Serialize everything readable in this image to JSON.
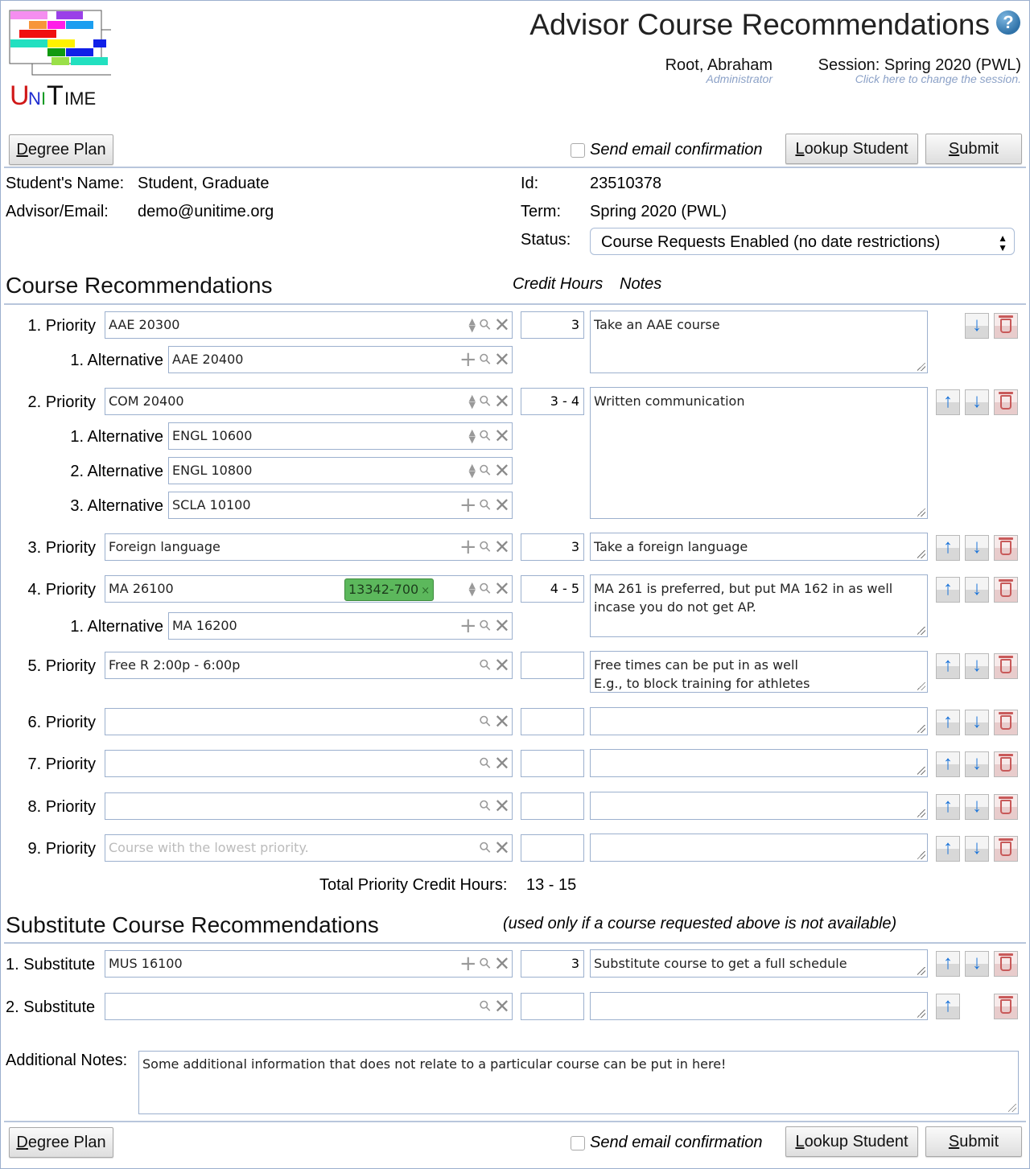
{
  "header": {
    "app_name": "UniTime",
    "title": "Advisor Course Recommendations",
    "help_icon": "?",
    "user_name": "Root, Abraham",
    "user_role": "Administrator",
    "session": "Session: Spring 2020 (PWL)",
    "session_hint": "Click here to change the session."
  },
  "toolbar": {
    "degree_plan": "Degree Plan",
    "send_email": "Send email confirmation",
    "send_email_checked": false,
    "lookup_student": "Lookup Student",
    "submit": "Submit"
  },
  "student": {
    "name_label": "Student's Name:",
    "name": "Student, Graduate",
    "advisor_label": "Advisor/Email:",
    "advisor_email": "demo@unitime.org",
    "id_label": "Id:",
    "id": "23510378",
    "term_label": "Term:",
    "term": "Spring 2020 (PWL)",
    "status_label": "Status:",
    "status": "Course Requests Enabled (no date restrictions)"
  },
  "recommendations": {
    "heading": "Course Recommendations",
    "credit_header": "Credit Hours",
    "notes_header": "Notes",
    "priorities": [
      {
        "label": "1. Priority",
        "course": "AAE 20300",
        "credit": "3",
        "notes": "Take an AAE course",
        "alternatives": [
          {
            "label": "1. Alternative",
            "course": "AAE 20400"
          }
        ]
      },
      {
        "label": "2. Priority",
        "course": "COM 20400",
        "credit": "3 - 4",
        "notes": "Written communication",
        "alternatives": [
          {
            "label": "1. Alternative",
            "course": "ENGL 10600"
          },
          {
            "label": "2. Alternative",
            "course": "ENGL 10800"
          },
          {
            "label": "3. Alternative",
            "course": "SCLA 10100"
          }
        ]
      },
      {
        "label": "3. Priority",
        "course": "Foreign language",
        "credit": "3",
        "notes": "Take a foreign language",
        "alternatives": []
      },
      {
        "label": "4. Priority",
        "course": "MA 26100",
        "section_tag": "13342-700",
        "credit": "4 - 5",
        "notes": "MA 261 is preferred, but put MA 162 in as well\nincase you do not get AP.",
        "alternatives": [
          {
            "label": "1. Alternative",
            "course": "MA 16200"
          }
        ]
      },
      {
        "label": "5. Priority",
        "course": "Free R 2:00p - 6:00p",
        "credit": "",
        "notes": "Free times can be put in as well\nE.g., to block training for athletes",
        "alternatives": []
      },
      {
        "label": "6. Priority",
        "course": "",
        "credit": "",
        "notes": "",
        "alternatives": []
      },
      {
        "label": "7. Priority",
        "course": "",
        "credit": "",
        "notes": "",
        "alternatives": []
      },
      {
        "label": "8. Priority",
        "course": "",
        "credit": "",
        "notes": "",
        "alternatives": []
      },
      {
        "label": "9. Priority",
        "course": "",
        "placeholder": "Course with the lowest priority.",
        "credit": "",
        "notes": "",
        "alternatives": []
      }
    ],
    "total_label": "Total Priority Credit Hours:",
    "total_value": "13 - 15"
  },
  "substitutes": {
    "heading": "Substitute Course Recommendations",
    "subheading": "(used only if a course requested above is not available)",
    "items": [
      {
        "label": "1. Substitute",
        "course": "MUS 16100",
        "credit": "3",
        "notes": "Substitute course to get a full schedule"
      },
      {
        "label": "2. Substitute",
        "course": "",
        "credit": "",
        "notes": ""
      }
    ]
  },
  "additional_notes": {
    "label": "Additional Notes:",
    "value": "Some additional information that does not relate to a particular course can be put in here!"
  },
  "colors": {
    "border": "#9cb0ce",
    "section_tag": "#5cb85c",
    "move_arrow": "#1a73d9",
    "delete": "#c85a5a"
  }
}
